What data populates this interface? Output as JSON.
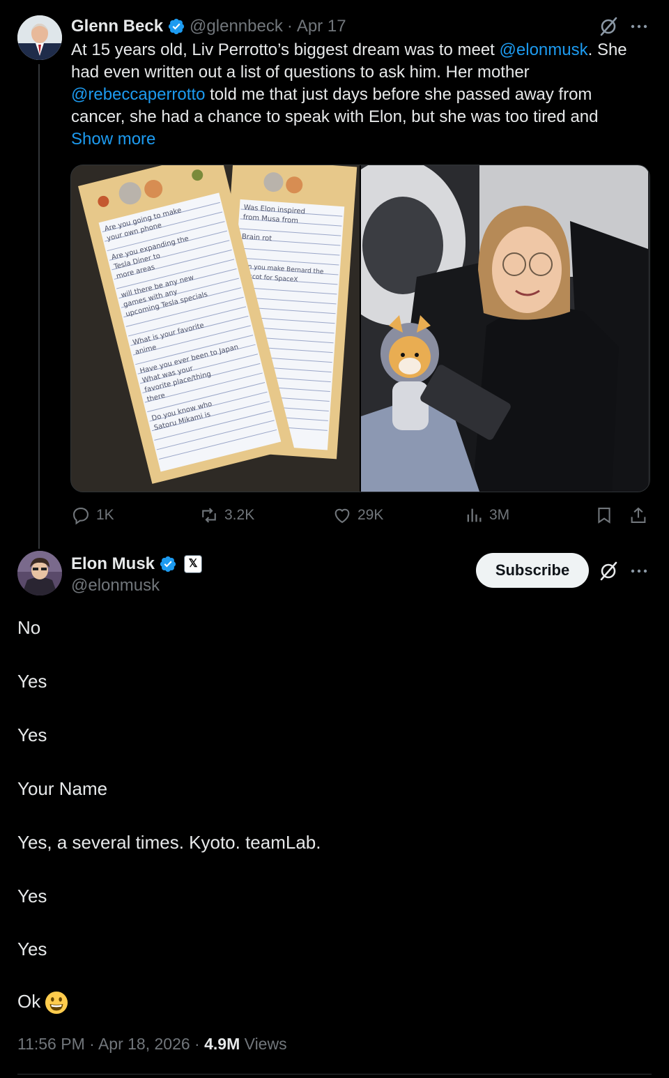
{
  "parent_tweet": {
    "author_name": "Glenn Beck",
    "handle": "@glennbeck",
    "date": "Apr 17",
    "separator": "·",
    "text_segments": [
      "At 15 years old, Liv Perrotto’s biggest dream was to meet ",
      "@elonmusk",
      ". She had even written out a list of questions to ask him. Her mother ",
      "@rebeccaperrotto",
      " told me that just days before she passed away from cancer, she had a chance to speak with Elon, but she was too tired and"
    ],
    "show_more": "Show more",
    "media": {
      "left_image": "handwritten-question-letters",
      "right_image": "girl-with-plush-in-spacecraft-seat",
      "letter_lines_left": [
        "Are you going to make",
        "your own phone",
        "Are you expanding the",
        "Tesla Diner to",
        "more areas",
        "will there be any new",
        "games with any",
        "upcoming Tesla specials",
        "What is your favorite",
        "anime",
        "Have you ever been to Japan",
        "What was your",
        "favorite place/thing",
        "there",
        "Do you know who",
        "Satoru Mikami is"
      ],
      "letter_lines_right": [
        "Was Elon inspired",
        "from Musa from",
        "Brain rot",
        "Can you make Bernard the",
        "mascot for SpaceX"
      ]
    },
    "actions": {
      "replies": "1K",
      "reposts": "3.2K",
      "likes": "29K",
      "views": "3M"
    }
  },
  "reply_tweet": {
    "author_name": "Elon Musk",
    "handle": "@elonmusk",
    "affiliate_badge": "𝕏",
    "subscribe_label": "Subscribe",
    "lines": [
      "No",
      "Yes",
      "Yes",
      "Your Name",
      "Yes, a several times. Kyoto. teamLab.",
      "Yes",
      "Yes",
      "Ok"
    ],
    "emoji": "grinning-face-emoji",
    "time": "11:56 PM",
    "date": "Apr 18, 2026",
    "views_count": "4.9M",
    "views_label": "Views",
    "separator": "·"
  },
  "colors": {
    "background": "#000000",
    "text": "#e7e9ea",
    "muted": "#71767b",
    "link": "#1d9bf0",
    "verified": "#1d9bf0",
    "subscribe_bg": "#eff3f4"
  }
}
